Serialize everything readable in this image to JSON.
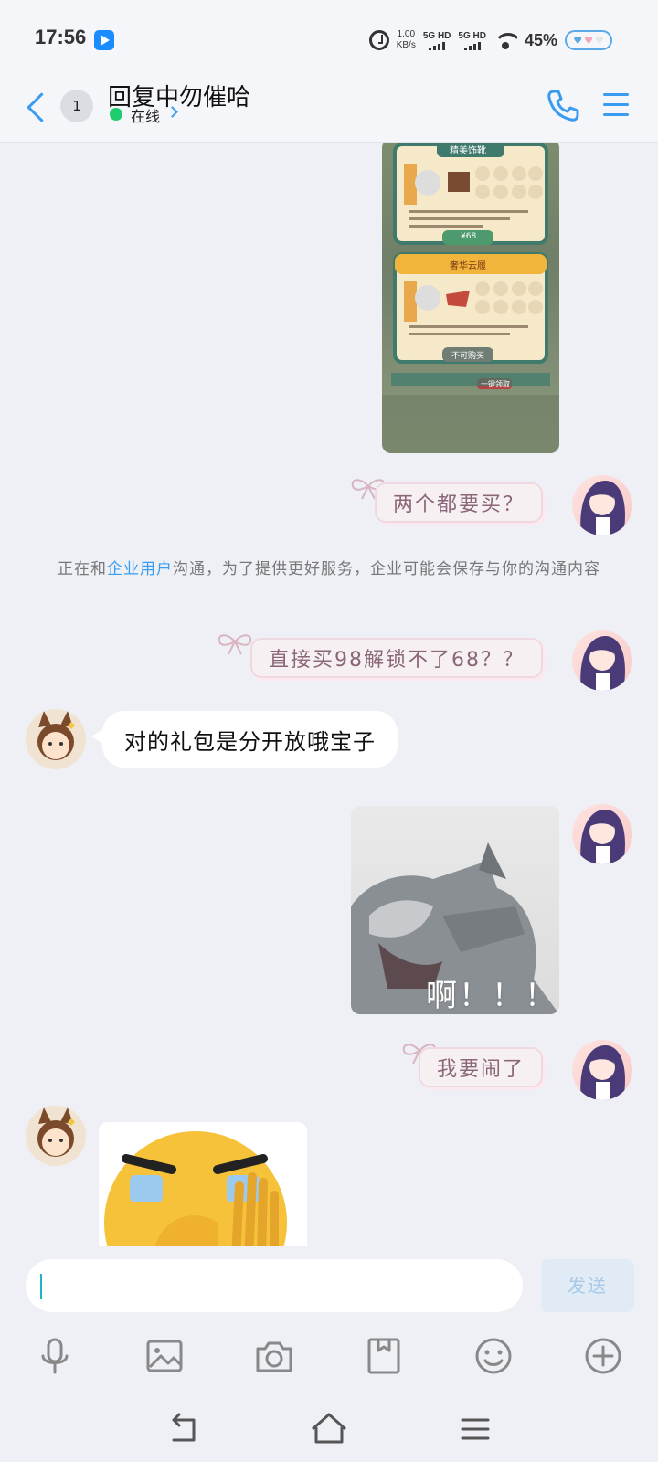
{
  "status_bar": {
    "time": "17:56",
    "speed_value": "1.00",
    "speed_unit": "KB/s",
    "net1": "5G HD",
    "net2": "5G HD",
    "battery_percent": "45%"
  },
  "header": {
    "unread_count": "1",
    "title": "回复中勿催哈",
    "status": "在线"
  },
  "messages": {
    "m1": "两个都要买？",
    "notice_before": "正在和",
    "notice_highlight": "企业用户",
    "notice_after": "沟通，为了提供更好服务，企业可能会保存与你的沟通内容",
    "m2": "直接买98解锁不了68？？",
    "m3": "对的礼包是分开放哦宝子",
    "cat_caption": "啊！！！",
    "m4": "我要闹了"
  },
  "game_image": {
    "panel1_title": "精美饰靴",
    "panel1_price": "¥68",
    "panel2_title": "奢华云履",
    "panel2_button": "不可购买",
    "corner_button": "一键领取"
  },
  "input": {
    "placeholder": "",
    "send_label": "发送"
  },
  "colors": {
    "accent": "#3a9cf0",
    "online": "#1fcd6e",
    "bubble_me_text": "#8a6678"
  },
  "icons": [
    "back-icon",
    "phone-icon",
    "menu-icon",
    "mic-icon",
    "image-icon",
    "camera-icon",
    "file-icon",
    "emoji-icon",
    "plus-icon",
    "back-nav-icon",
    "home-icon",
    "recent-apps-icon"
  ]
}
